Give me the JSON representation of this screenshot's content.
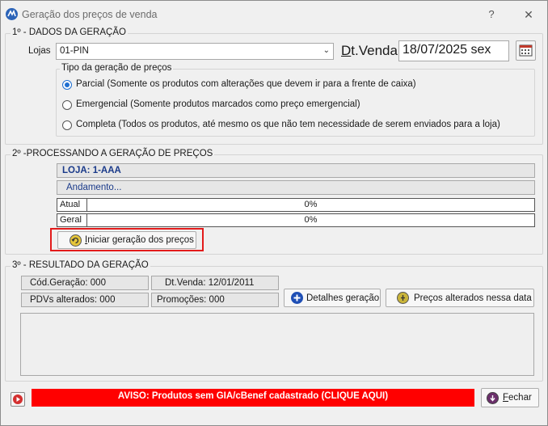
{
  "window": {
    "title": "Geração dos preços de venda",
    "help_glyph": "?",
    "close_glyph": "✕"
  },
  "section1": {
    "title": "1º - DADOS DA GERAÇÃO",
    "lojas_label": "Lojas",
    "lojas_value": "01-PIN",
    "dtvenda_label_underlined": "D",
    "dtvenda_label_rest": "t.Venda",
    "dtvenda_value": "18/07/2025 sex",
    "tipo_title": "Tipo da geração de preços",
    "options": [
      {
        "label": "Parcial (Somente os produtos com alterações que devem ir para a frente de caixa)",
        "selected": true
      },
      {
        "label": "Emergencial (Somente produtos marcados como preço emergencial)",
        "selected": false
      },
      {
        "label": "Completa (Todos os produtos, até mesmo os que não tem necessidade de serem enviados para a loja)",
        "selected": false
      }
    ]
  },
  "section2": {
    "title": "2º -PROCESSANDO A GERAÇÃO DE PREÇOS",
    "loja_text": "LOJA: 1-AAA",
    "andamento_text": "Andamento...",
    "progress": [
      {
        "label": "Atual",
        "percent_text": "0%",
        "value": 0
      },
      {
        "label": "Geral",
        "percent_text": "0%",
        "value": 0
      }
    ],
    "start_button_label": "Iniciar geração dos preços",
    "start_button_hotkey": "I",
    "start_button_rest": "niciar geração dos preços"
  },
  "section3": {
    "title": "3º - RESULTADO DA GERAÇÃO",
    "cod_geracao": "Cód.Geração: 000",
    "dt_venda": "Dt.Venda: 12/01/2011",
    "pdvs_alterados": "PDVs alterados: 000",
    "promocoes": "Promoções: 000",
    "detalhes_button": "Detalhes geração",
    "precos_alterados_button": "Preços alterados nessa data"
  },
  "footer": {
    "warning": "AVISO: Produtos sem GIA/cBenef cadastrado (CLIQUE AQUI)",
    "close_button_hotkey": "F",
    "close_button_rest": "echar"
  },
  "colors": {
    "warning_bg": "#ff0000",
    "radio_selected": "#1f6fd1",
    "loja_text": "#1a3a8a",
    "highlight_outline": "#e31b1b"
  },
  "icons": {
    "app": "app-logo-icon",
    "calendar": "calendar-icon",
    "start": "refresh-icon",
    "details": "plus-circle-icon",
    "prices": "price-tag-icon",
    "close": "arrow-down-circle-icon",
    "play": "play-icon"
  }
}
